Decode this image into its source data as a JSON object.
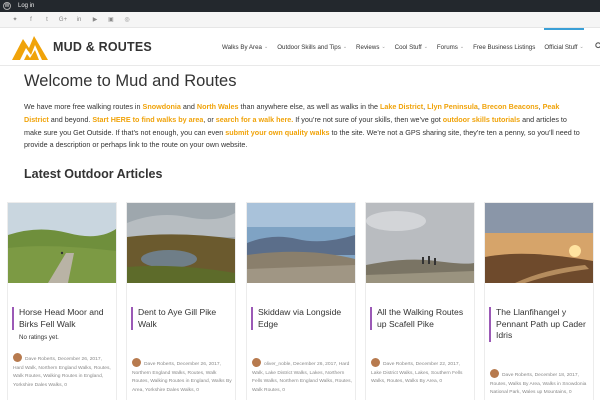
{
  "admin_bar": {
    "wp_logo": "wordpress-icon",
    "login_label": "Log in"
  },
  "social_icons": [
    "twitter-icon",
    "facebook-icon",
    "tumblr-icon",
    "googleplus-icon",
    "linkedin-icon",
    "youtube-icon",
    "instagram-icon",
    "flickr-icon"
  ],
  "social_glyphs": [
    "✦",
    "f",
    "t",
    "G+",
    "in",
    "▶",
    "▣",
    "◎"
  ],
  "site": {
    "logo_text": "MUD & ROUTES",
    "accent": "#f0a30a",
    "nav_active_color": "#3a9fd6"
  },
  "nav": {
    "items": [
      {
        "label": "Walks By Area",
        "has_dropdown": true
      },
      {
        "label": "Outdoor Skills and Tips",
        "has_dropdown": true
      },
      {
        "label": "Reviews",
        "has_dropdown": true
      },
      {
        "label": "Cool Stuff",
        "has_dropdown": true
      },
      {
        "label": "Forums",
        "has_dropdown": true
      },
      {
        "label": "Free Business Listings",
        "has_dropdown": false
      },
      {
        "label": "Official Stuff",
        "has_dropdown": true
      }
    ],
    "search_icon": "search-icon"
  },
  "welcome": {
    "title": "Welcome to Mud and Routes",
    "intro_parts": [
      {
        "t": "We have more free walking routes in ",
        "link": false
      },
      {
        "t": "Snowdonia",
        "link": true
      },
      {
        "t": " and ",
        "link": false
      },
      {
        "t": "North Wales",
        "link": true
      },
      {
        "t": " than anywhere else, as well as walks in the ",
        "link": false
      },
      {
        "t": "Lake District",
        "link": true
      },
      {
        "t": ", ",
        "link": false
      },
      {
        "t": "Llyn Peninsula",
        "link": true
      },
      {
        "t": ", ",
        "link": false
      },
      {
        "t": "Brecon Beacons",
        "link": true
      },
      {
        "t": ", ",
        "link": false
      },
      {
        "t": "Peak District",
        "link": true
      },
      {
        "t": " and beyond. ",
        "link": false
      },
      {
        "t": "Start HERE to find walks by area",
        "link": true
      },
      {
        "t": ", or ",
        "link": false
      },
      {
        "t": "search for a walk here.",
        "link": true
      },
      {
        "t": " If you’re not sure of your skills, then we’ve got ",
        "link": false
      },
      {
        "t": "outdoor skills tutorials",
        "link": true
      },
      {
        "t": " and articles to make sure you Get Outside. If that’s not enough, you can even ",
        "link": false
      },
      {
        "t": "submit your own quality walks",
        "link": true
      },
      {
        "t": " to the site. We’re not a GPS sharing site, they’re ten a penny, so you’ll need to provide a description or perhaps link to the route on your own website.",
        "link": false
      }
    ]
  },
  "latest": {
    "heading": "Latest Outdoor Articles",
    "cards": [
      {
        "title": "Horse Head Moor and Birks Fell Walk",
        "rating": "No ratings yet.",
        "meta": "Dave Roberts, December 26, 2017, Hard Walk, Northern England Walks, Routes, Walk Routes, Walking Routes in England, Yorkshire Dales Walks, 0"
      },
      {
        "title": "Dent to Aye Gill Pike Walk",
        "rating": "",
        "meta": "Dave Roberts, December 26, 2017, Northern England Walks, Routes, Walk Routes, Walking Routes in England, Walks By Area, Yorkshire Dales Walks, 0"
      },
      {
        "title": "Skiddaw via Longside Edge",
        "rating": "",
        "meta": "oliver_noble, December 26, 2017, Hard Walk, Lake District Walks, Lakes, Northern Fells Walks, Northern England Walks, Routes, Walk Routes, 0"
      },
      {
        "title": "All the Walking Routes up Scafell Pike",
        "rating": "",
        "meta": "Dave Roberts, December 22, 2017, Lake District Walks, Lakes, Southern Fells Walks, Routes, Walks By Area, 0"
      },
      {
        "title": "The Llanfihangel y Pennant Path up Cader Idris",
        "rating": "",
        "meta": "Dave Roberts, December 18, 2017, Routes, Walks By Area, Walks in Snowdonia National Park, Wales up Mountains, 0"
      }
    ]
  }
}
